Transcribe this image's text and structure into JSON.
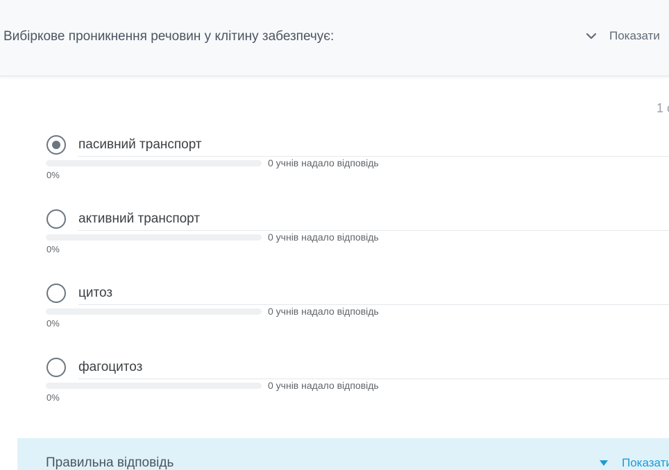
{
  "question": {
    "title": "Вибіркове проникнення речовин у клітину забезпечує:",
    "toggle_label": "Показати",
    "toggle_icon": "chevron-down-icon"
  },
  "counter": "1 с",
  "options": [
    {
      "label": "пасивний транспорт",
      "selected": true,
      "answers_text": "0 учнів надало відповідь",
      "percent_text": "0%",
      "percent": 0
    },
    {
      "label": "активний транспорт",
      "selected": false,
      "answers_text": "0 учнів надало відповідь",
      "percent_text": "0%",
      "percent": 0
    },
    {
      "label": "цитоз",
      "selected": false,
      "answers_text": "0 учнів надало відповідь",
      "percent_text": "0%",
      "percent": 0
    },
    {
      "label": "фагоцитоз",
      "selected": false,
      "answers_text": "0 учнів надало відповідь",
      "percent_text": "0%",
      "percent": 0
    }
  ],
  "correct_answer": {
    "title": "Правильна відповідь",
    "toggle_label": "Показати",
    "toggle_icon": "triangle-down-icon"
  },
  "colors": {
    "header_bg": "#f8f9fb",
    "correct_bg": "#dff2fa",
    "accent": "#1a9bd7",
    "radio": "#6b7680"
  }
}
